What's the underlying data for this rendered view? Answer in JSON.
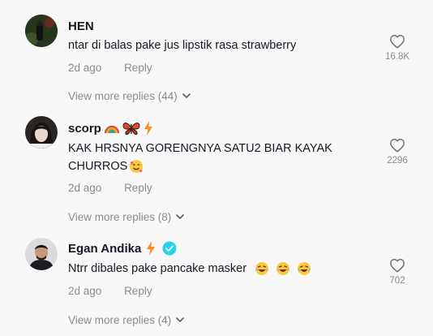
{
  "comments": [
    {
      "username": "HEN",
      "text": "ntar di balas pake jus lipstik rasa strawberry",
      "time": "2d ago",
      "reply_label": "Reply",
      "likes": "16.8K",
      "more_replies": "View more replies (44)"
    },
    {
      "username": "scorp",
      "text_line1": "KAK HRSNYA GORENGNYA SATU2 BIAR KAYAK",
      "text_line2": "CHURROS",
      "time": "2d ago",
      "reply_label": "Reply",
      "likes": "2296",
      "more_replies": "View more replies (8)"
    },
    {
      "username": "Egan Andika",
      "text": "Ntrr dibales pake pancake masker",
      "time": "2d ago",
      "reply_label": "Reply",
      "likes": "702",
      "more_replies": "View more replies (4)"
    }
  ],
  "icons": {
    "like": "heart-outline-icon",
    "expand": "chevron-down-icon",
    "verified": "verified-badge-icon",
    "emoji_scorp_name": [
      "rainbow-emoji",
      "butterfly-emoji",
      "lightning-icon"
    ],
    "emoji_egan_name": [
      "lightning-icon",
      "verified-badge-icon"
    ],
    "emoji_scorp_text": "smiling-face-with-hearts-emoji",
    "emoji_egan_text": "laughing-face-emoji"
  },
  "colors": {
    "accent_lightning": "#ff8a1f",
    "verified": "#20d5ec",
    "muted_text": "#8a8b91",
    "background": "#f8f8f8"
  }
}
